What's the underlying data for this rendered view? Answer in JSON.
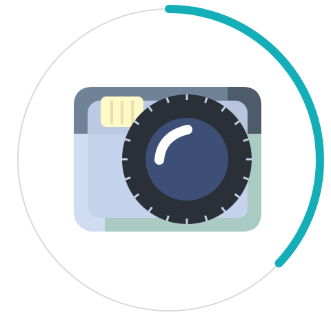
{
  "progress": {
    "value_fraction": 0.37,
    "track_color": "#d9d9d9",
    "fill_color": "#14aeb8"
  },
  "icon": {
    "name": "camera-icon",
    "colors": {
      "body_light": "#cfdcf2",
      "body_shade": "#c3d0ea",
      "top_band": "#6f8296",
      "top_band_dark": "#4d5b6b",
      "teal_panel": "#a9cbc4",
      "teal_panel_light": "#bddcd4",
      "flash": "#fff9c9",
      "lens_outer": "#2b3038",
      "lens_inner": "#3d4e77",
      "lens_highlight": "#ffffff"
    }
  }
}
